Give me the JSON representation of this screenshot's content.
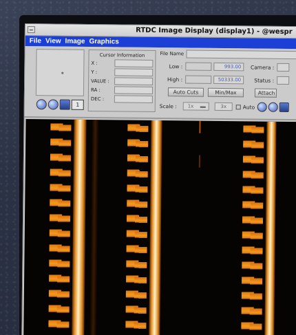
{
  "window": {
    "title": "RTDC Image Display (display1) - @wespr"
  },
  "menubar": {
    "items": [
      "File",
      "View",
      "Image",
      "Graphics"
    ]
  },
  "cursor_info": {
    "title": "Cursor Information",
    "labels": [
      "X :",
      "Y :",
      "VALUE :",
      "RA :",
      "DEC :"
    ]
  },
  "file": {
    "label": "File Name",
    "value": ""
  },
  "cuts": {
    "low_label": "Low :",
    "low_value": "993.00",
    "high_label": "High :",
    "high_value": "50333.00"
  },
  "camera": {
    "camera_label": "Camera :",
    "status_label": "Status :"
  },
  "buttons": {
    "auto_cuts": "Auto Cuts",
    "min_max": "Min/Max",
    "attach": "Attach"
  },
  "scale": {
    "label": "Scale :",
    "value": "1x",
    "second": "3x",
    "auto_label": "Auto"
  },
  "zoom_row": {
    "box_label": "1"
  },
  "colors": {
    "menubar": "#1c3fd6",
    "panel": "#cbcbcb",
    "fiber": "#f49a20",
    "stripe": "#fff1c8"
  }
}
